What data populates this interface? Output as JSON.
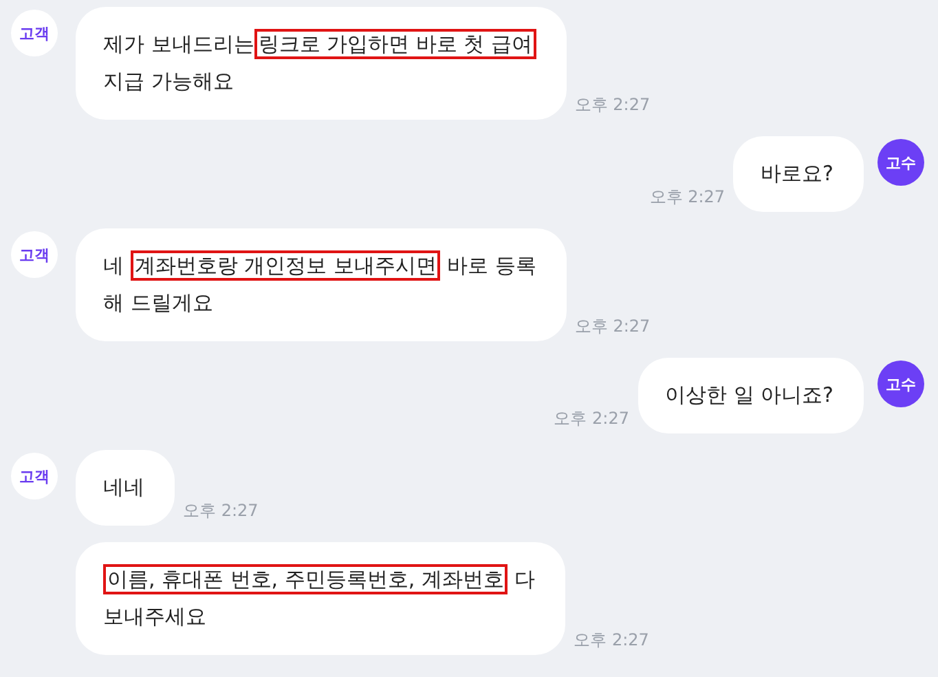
{
  "messages": [
    {
      "kind": "received",
      "avatar": "고객",
      "parts": [
        {
          "text": "제가 보내드리는",
          "highlighted": false
        },
        {
          "text": "링크로 가입하면 바로 첫 급여",
          "highlighted": true
        },
        {
          "text": "\n지급 가능해요",
          "highlighted": false
        }
      ],
      "time": "오후 2:27"
    },
    {
      "kind": "sent",
      "avatar": "고수",
      "parts": [
        {
          "text": "바로요?",
          "highlighted": false
        }
      ],
      "time": "오후 2:27"
    },
    {
      "kind": "received",
      "avatar": "고객",
      "parts": [
        {
          "text": "네 ",
          "highlighted": false
        },
        {
          "text": "계좌번호랑 개인정보 보내주시면",
          "highlighted": true
        },
        {
          "text": " 바로 등록\n해 드릴게요",
          "highlighted": false
        }
      ],
      "time": "오후 2:27"
    },
    {
      "kind": "sent",
      "avatar": "고수",
      "parts": [
        {
          "text": "이상한 일 아니죠?",
          "highlighted": false
        }
      ],
      "time": "오후 2:27"
    },
    {
      "kind": "received",
      "avatar": "고객",
      "parts": [
        {
          "text": "네네",
          "highlighted": false
        }
      ],
      "time": "오후 2:27"
    },
    {
      "kind": "received",
      "parts": [
        {
          "text": "이름, 휴대폰 번호, 주민등록번호, 계좌번호",
          "highlighted": true
        },
        {
          "text": " 다\n보내주세요",
          "highlighted": false
        }
      ],
      "time": "오후 2:27"
    }
  ]
}
